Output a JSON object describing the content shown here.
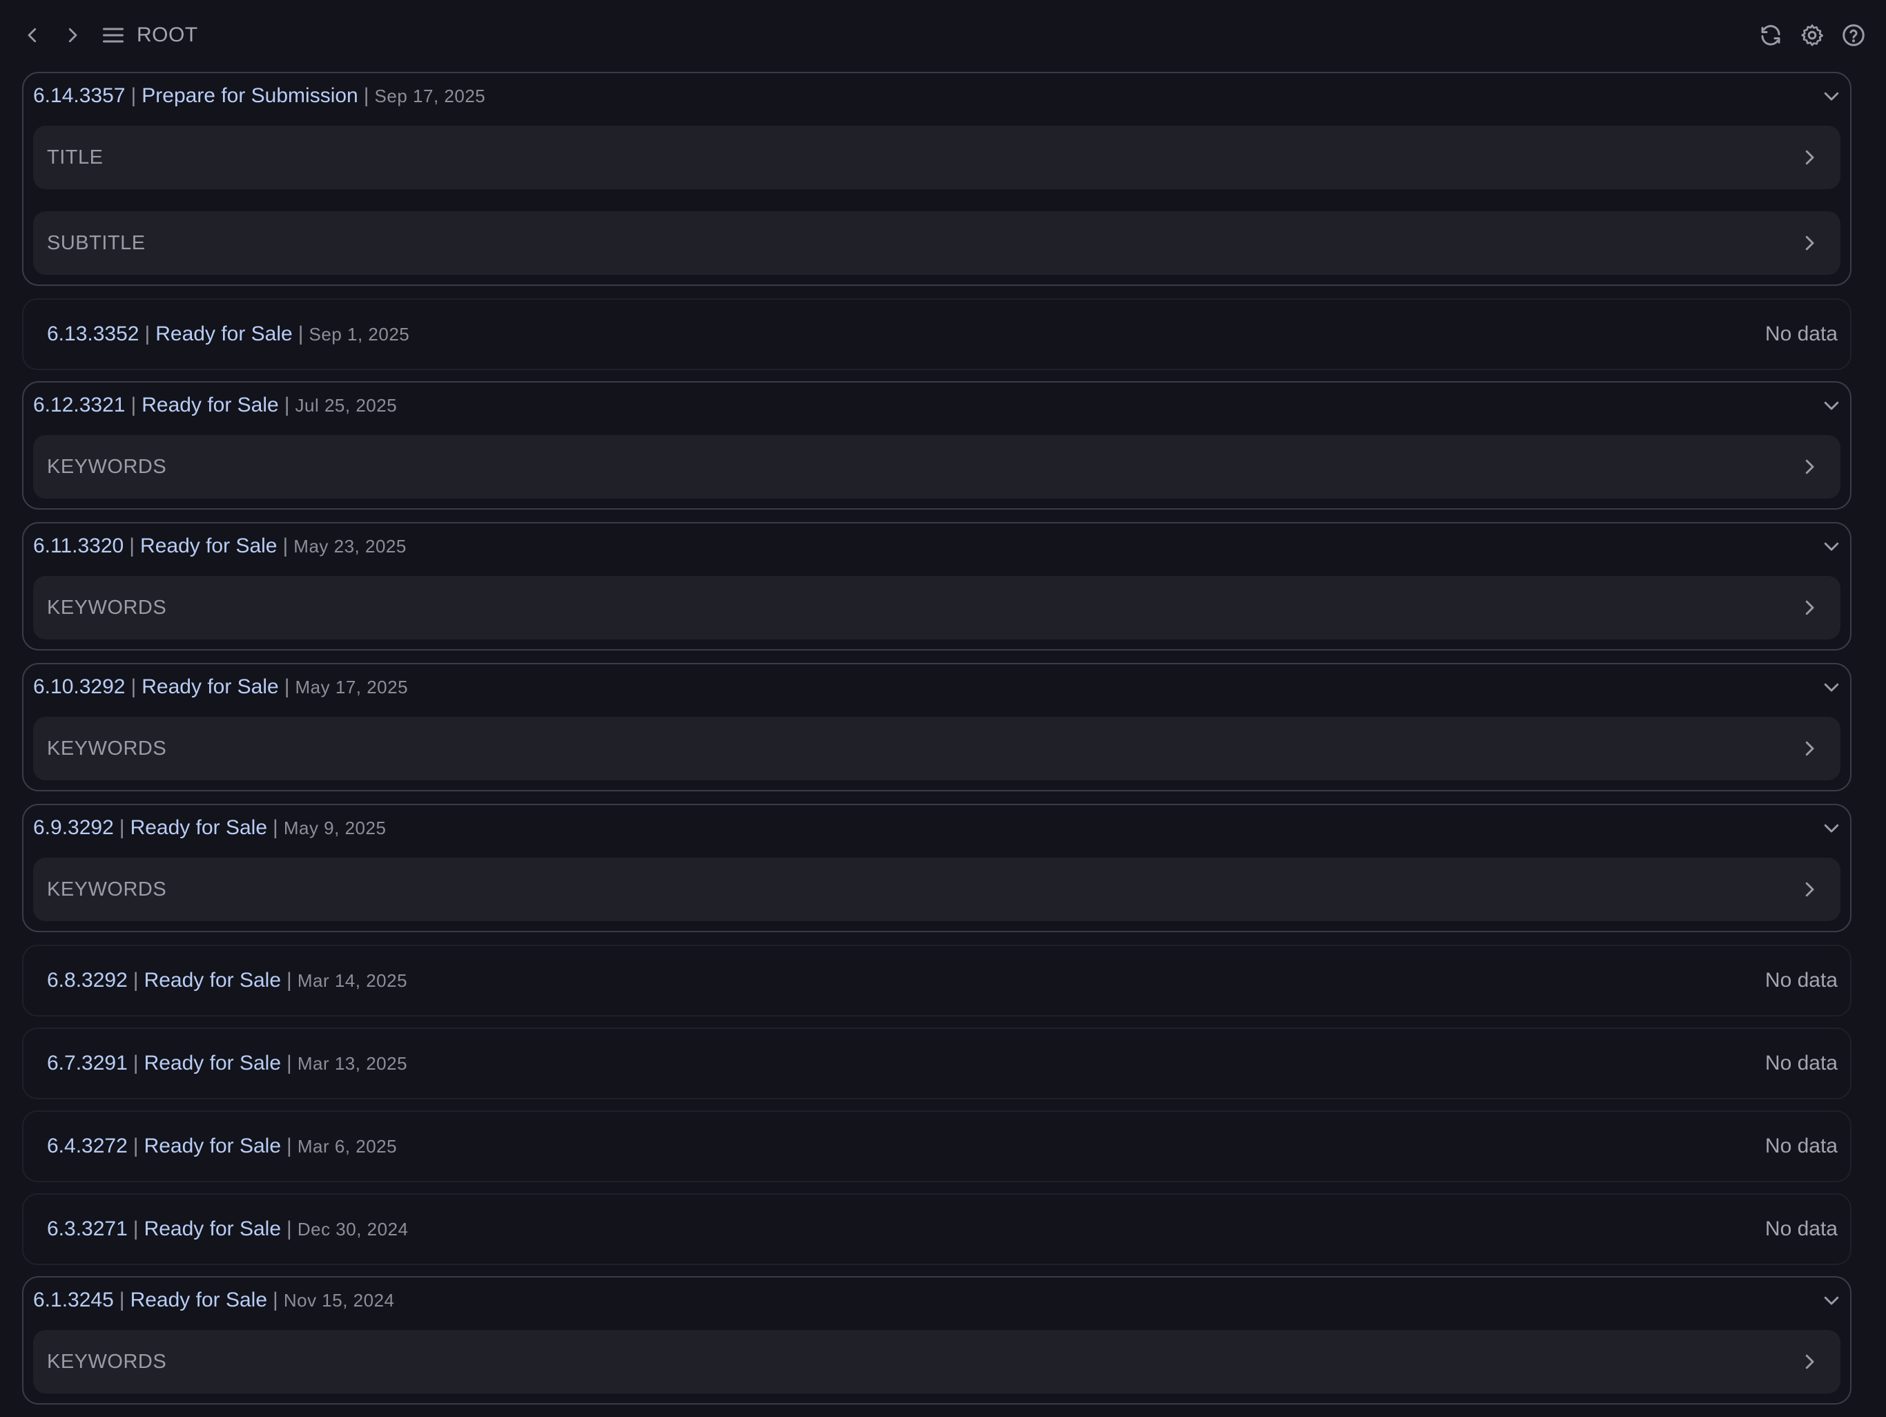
{
  "topbar": {
    "back_icon": "chevron-left-icon",
    "forward_icon": "chevron-right-icon",
    "menu_icon": "hamburger-icon",
    "breadcrumb": "ROOT",
    "actions": [
      "refresh-icon",
      "gear-icon",
      "help-icon"
    ]
  },
  "versions": [
    {
      "version": "6.14.3357",
      "status": "Prepare for Submission",
      "date": "Sep 17, 2025",
      "expanded": true,
      "items": [
        "TITLE",
        "SUBTITLE"
      ]
    },
    {
      "version": "6.13.3352",
      "status": "Ready for Sale",
      "date": "Sep 1, 2025",
      "expanded": false,
      "no_data": "No data"
    },
    {
      "version": "6.12.3321",
      "status": "Ready for Sale",
      "date": "Jul 25, 2025",
      "expanded": true,
      "items": [
        "KEYWORDS"
      ]
    },
    {
      "version": "6.11.3320",
      "status": "Ready for Sale",
      "date": "May 23, 2025",
      "expanded": true,
      "items": [
        "KEYWORDS"
      ]
    },
    {
      "version": "6.10.3292",
      "status": "Ready for Sale",
      "date": "May 17, 2025",
      "expanded": true,
      "items": [
        "KEYWORDS"
      ]
    },
    {
      "version": "6.9.3292",
      "status": "Ready for Sale",
      "date": "May 9, 2025",
      "expanded": true,
      "items": [
        "KEYWORDS"
      ]
    },
    {
      "version": "6.8.3292",
      "status": "Ready for Sale",
      "date": "Mar 14, 2025",
      "expanded": false,
      "no_data": "No data"
    },
    {
      "version": "6.7.3291",
      "status": "Ready for Sale",
      "date": "Mar 13, 2025",
      "expanded": false,
      "no_data": "No data"
    },
    {
      "version": "6.4.3272",
      "status": "Ready for Sale",
      "date": "Mar 6, 2025",
      "expanded": false,
      "no_data": "No data"
    },
    {
      "version": "6.3.3271",
      "status": "Ready for Sale",
      "date": "Dec 30, 2024",
      "expanded": false,
      "no_data": "No data"
    },
    {
      "version": "6.1.3245",
      "status": "Ready for Sale",
      "date": "Nov 15, 2024",
      "expanded": true,
      "items": [
        "KEYWORDS"
      ]
    }
  ],
  "separator": "|",
  "colors": {
    "background": "#12131b",
    "version_text": "#b9cdf5",
    "row_fill": "#202128",
    "card_border": "#3a3c47"
  }
}
